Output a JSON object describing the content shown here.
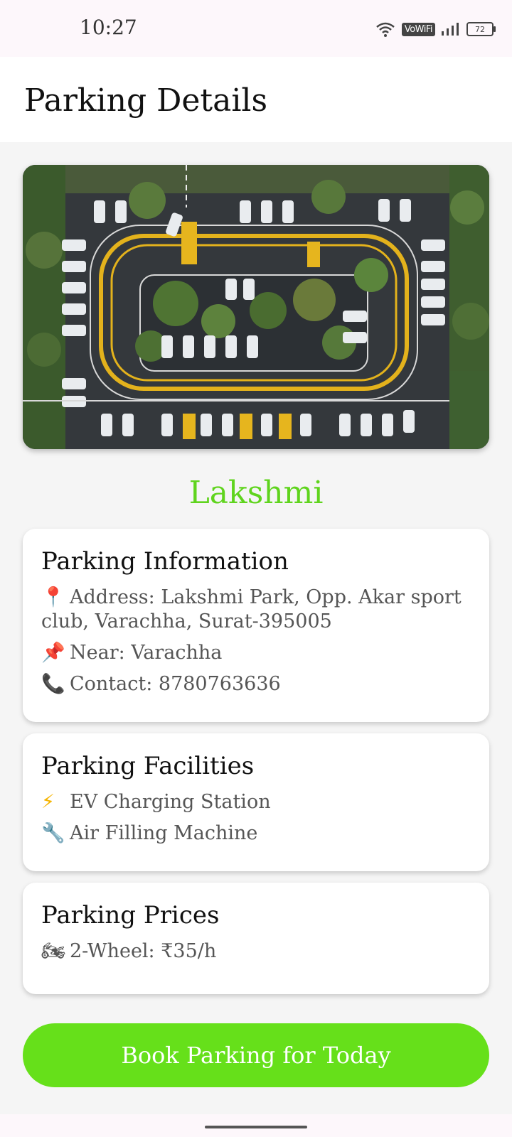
{
  "status_bar": {
    "time": "10:27",
    "network_label": "VoWiFi",
    "battery": "72",
    "icons": [
      "wifi-icon",
      "signal-icon",
      "battery-icon"
    ]
  },
  "app_bar": {
    "title": "Parking Details"
  },
  "hero_image": {
    "icon": "parking-lot-aerial-photo"
  },
  "place": {
    "name": "Lakshmi",
    "color": "#5fd41d"
  },
  "info_card": {
    "title": "Parking Information",
    "address": "Address: Lakshmi Park, Opp. Akar sport club, Varachha, Surat-395005",
    "near": "Near: Varachha",
    "contact": "Contact: 8780763636",
    "icons": [
      "pin-icon",
      "pushpin-icon",
      "phone-icon"
    ]
  },
  "facilities_card": {
    "title": "Parking Facilities",
    "items": [
      "EV Charging Station",
      "Air Filling Machine"
    ],
    "icons": [
      "lightning-icon",
      "wrench-icon"
    ]
  },
  "prices_card": {
    "title": "Parking Prices",
    "items": [
      "2-Wheel: ₹35/h"
    ],
    "icons": [
      "motorcycle-icon"
    ]
  },
  "book_button": {
    "label": "Book Parking for Today",
    "color": "#66e01a"
  }
}
